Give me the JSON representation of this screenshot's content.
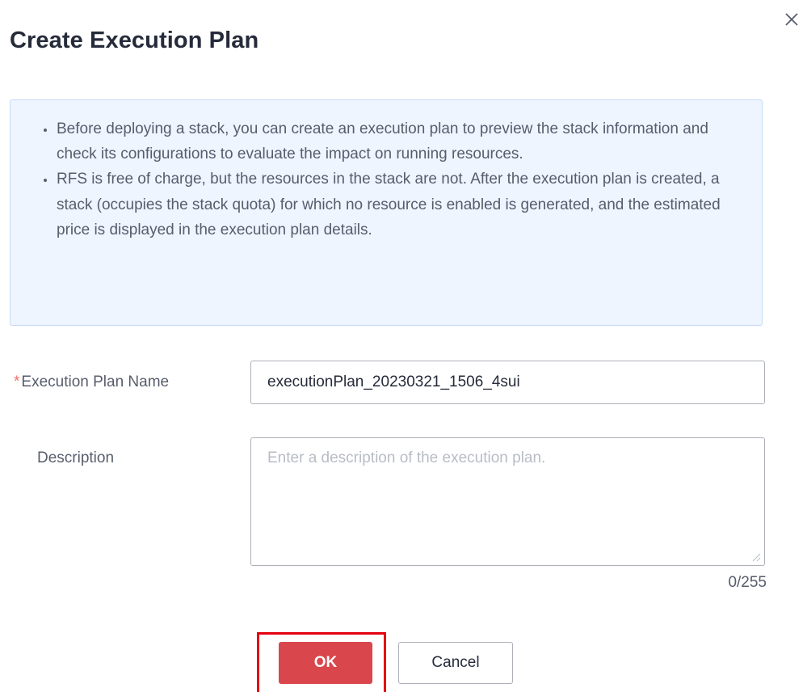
{
  "dialog": {
    "title": "Create Execution Plan",
    "close_icon": "close-icon"
  },
  "info": {
    "items": [
      "Before deploying a stack, you can create an execution plan to preview the stack information and check its configurations to evaluate the impact on running resources.",
      "RFS is free of charge, but the resources in the stack are not. After the execution plan is created, a stack (occupies the stack quota) for which no resource is enabled is generated, and the estimated price is displayed in the execution plan details."
    ]
  },
  "form": {
    "name_label": "Execution Plan Name",
    "name_required_mark": "*",
    "name_value": "executionPlan_20230321_1506_4sui",
    "description_label": "Description",
    "description_value": "",
    "description_placeholder": "Enter a description of the execution plan.",
    "char_count": "0/255"
  },
  "buttons": {
    "ok_label": "OK",
    "cancel_label": "Cancel"
  },
  "colors": {
    "primary_danger": "#d9464c",
    "highlight_border": "#e4000f",
    "info_background": "#eef5ff",
    "required_star": "#f66f6a"
  }
}
